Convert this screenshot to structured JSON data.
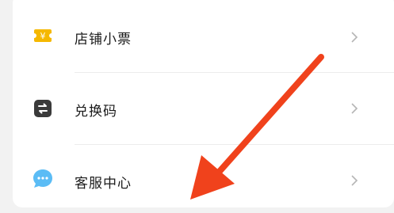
{
  "menu": {
    "items": [
      {
        "label": "店铺小票",
        "icon": "receipt-ticket-icon"
      },
      {
        "label": "兑换码",
        "icon": "exchange-icon"
      },
      {
        "label": "客服中心",
        "icon": "chat-bubble-icon"
      }
    ]
  },
  "colors": {
    "ticket_icon": "#f5b800",
    "exchange_icon": "#3a3a3a",
    "chat_icon": "#5bbcf5",
    "arrow": "#f0421c"
  }
}
